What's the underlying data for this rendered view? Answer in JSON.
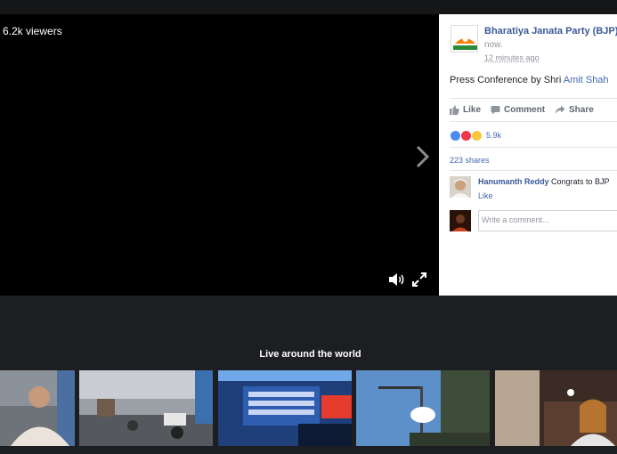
{
  "video": {
    "viewers": "6.2k viewers"
  },
  "post": {
    "page_name": "Bharatiya Janata Party (BJP)",
    "status": "now.",
    "timestamp": "12 minutes ago",
    "text_prefix": "Press Conference by Shri ",
    "text_link": "Amit Shah"
  },
  "actions": {
    "like": "Like",
    "comment": "Comment",
    "share": "Share"
  },
  "reactions": {
    "count": "5.9k",
    "icons": [
      "like-icon",
      "love-icon",
      "wow-icon"
    ]
  },
  "shares": "223 shares",
  "comment": {
    "author": "Hanumanth Reddy",
    "text": "Congrats to BJP",
    "like_label": "Like"
  },
  "composer": {
    "placeholder": "Write a comment..."
  },
  "live_section": {
    "title": "Live around the world"
  },
  "colors": {
    "link": "#4267b2",
    "name": "#385898",
    "background": "#1d1e21"
  }
}
